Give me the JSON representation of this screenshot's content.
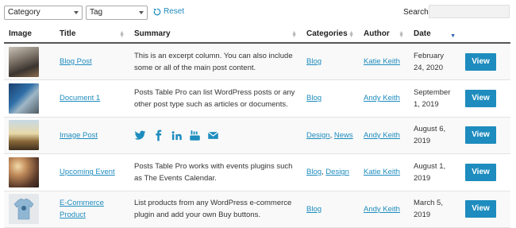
{
  "filters": {
    "category_label": "Category",
    "tag_label": "Tag",
    "reset_label": "Reset",
    "search_label": "Search:"
  },
  "columns": [
    "Image",
    "Title",
    "Summary",
    "Categories",
    "Author",
    "Date"
  ],
  "rows": [
    {
      "title": "Blog Post",
      "summary": "This is an excerpt column. You can also include some or all of the main post content.",
      "categories": [
        "Blog"
      ],
      "author": "Katie Keith",
      "date": "February 24, 2020",
      "view_label": "View"
    },
    {
      "title": "Document 1",
      "summary": "Posts Table Pro can list WordPress posts or any other post type such as articles or documents.",
      "categories": [
        "Blog"
      ],
      "author": "Andy Keith",
      "date": "September 1, 2019",
      "view_label": "View"
    },
    {
      "title": "Image Post",
      "summary": "",
      "summary_icons": [
        "twitter-icon",
        "facebook-icon",
        "linkedin-icon",
        "youtube-icon",
        "email-icon"
      ],
      "categories": [
        "Design",
        "News"
      ],
      "author": "Andy Keith",
      "date": "August 6, 2019",
      "view_label": "View"
    },
    {
      "title": "Upcoming Event",
      "summary": "Posts Table Pro works with events plugins such as The Events Calendar.",
      "categories": [
        "Blog",
        "Design"
      ],
      "author": "Katie Keith",
      "date": "August 1, 2019",
      "view_label": "View"
    },
    {
      "title": "E-Commerce Product",
      "summary": "List products from any WordPress e-commerce plugin and add your own Buy buttons.",
      "categories": [
        "Blog"
      ],
      "author": "Andy Keith",
      "date": "March 5, 2019",
      "view_label": "View"
    }
  ],
  "colors": {
    "accent": "#1e8cbe",
    "header_border": "#555555"
  }
}
